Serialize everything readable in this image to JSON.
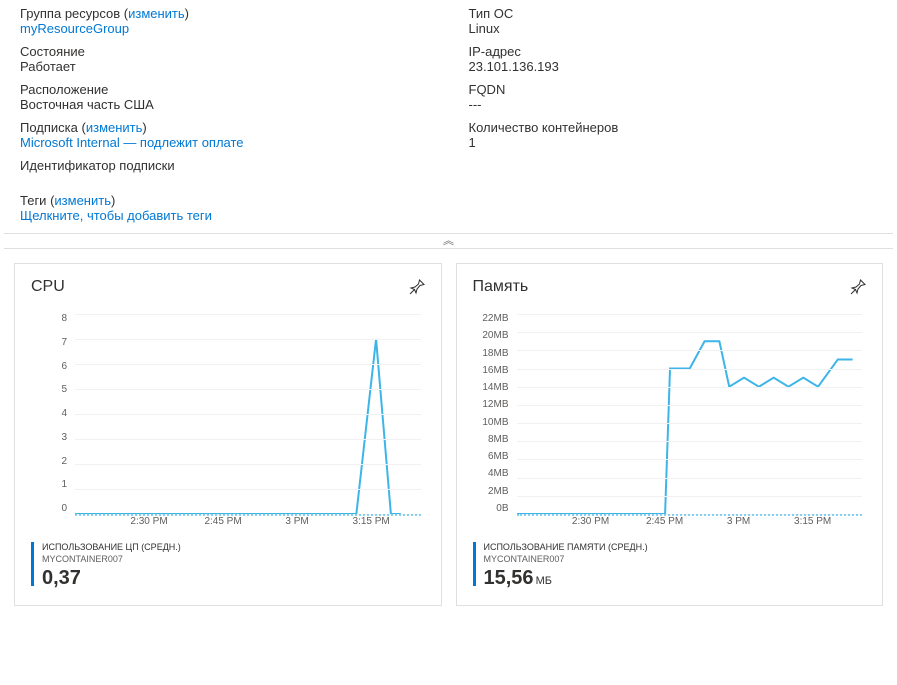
{
  "overview": {
    "left": [
      {
        "label": "Группа ресурсов",
        "changeLink": "изменить",
        "value": "myResourceGroup",
        "valueIsLink": true
      },
      {
        "label": "Состояние",
        "value": "Работает"
      },
      {
        "label": "Расположение",
        "value": "Восточная часть США"
      },
      {
        "label": "Подписка",
        "changeLink": "изменить",
        "value": "Microsoft Internal — подлежит оплате",
        "valueIsLink": true
      },
      {
        "label": "Идентификатор подписки",
        "value": ""
      }
    ],
    "right": [
      {
        "label": "Тип ОС",
        "value": "Linux"
      },
      {
        "label": "IP-адрес",
        "value": "23.101.136.193"
      },
      {
        "label": "FQDN",
        "value": "---"
      },
      {
        "label": "Количество контейнеров",
        "value": "1"
      }
    ],
    "tags": {
      "label": "Теги",
      "changeLink": "изменить",
      "addLink": "Щелкните, чтобы добавить теги"
    }
  },
  "collapseGlyph": "︽",
  "charts": {
    "cpu": {
      "title": "CPU",
      "metricName": "ИСПОЛЬЗОВАНИЕ ЦП (СРЕДН.)",
      "resource": "MYCONTAINER007",
      "value": "0,37",
      "unit": ""
    },
    "memory": {
      "title": "Память",
      "metricName": "ИСПОЛЬЗОВАНИЕ ПАМЯТИ (СРЕДН.)",
      "resource": "MYCONTAINER007",
      "value": "15,56",
      "unit": "МБ"
    }
  },
  "chart_data": [
    {
      "type": "line",
      "title": "CPU",
      "ylabel": "",
      "xlabel": "",
      "ylim": [
        0,
        8
      ],
      "y_ticks": [
        0,
        1,
        2,
        3,
        4,
        5,
        6,
        7,
        8
      ],
      "x_ticks": [
        "2:30 PM",
        "2:45 PM",
        "3 PM",
        "3:15 PM"
      ],
      "x_range_minutes": [
        135,
        205
      ],
      "series": [
        {
          "name": "ИСПОЛЬЗОВАНИЕ ЦП (СРЕДН.) — MYCONTAINER007",
          "points": [
            {
              "t": 135,
              "v": 0
            },
            {
              "t": 192,
              "v": 0
            },
            {
              "t": 196,
              "v": 7
            },
            {
              "t": 199,
              "v": 0
            },
            {
              "t": 201,
              "v": 0
            }
          ]
        }
      ]
    },
    {
      "type": "line",
      "title": "Память",
      "ylabel": "",
      "xlabel": "",
      "ylim": [
        0,
        22
      ],
      "y_ticks_labels": [
        "0B",
        "2MB",
        "4MB",
        "6MB",
        "8MB",
        "10MB",
        "12MB",
        "14MB",
        "16MB",
        "18MB",
        "20MB",
        "22MB"
      ],
      "x_ticks": [
        "2:30 PM",
        "2:45 PM",
        "3 PM",
        "3:15 PM"
      ],
      "x_range_minutes": [
        135,
        205
      ],
      "series": [
        {
          "name": "ИСПОЛЬЗОВАНИЕ ПАМЯТИ (СРЕДН.) — MYCONTAINER007",
          "points": [
            {
              "t": 135,
              "v": 0
            },
            {
              "t": 165,
              "v": 0
            },
            {
              "t": 166,
              "v": 16
            },
            {
              "t": 170,
              "v": 16
            },
            {
              "t": 173,
              "v": 19
            },
            {
              "t": 176,
              "v": 19
            },
            {
              "t": 178,
              "v": 14
            },
            {
              "t": 181,
              "v": 15
            },
            {
              "t": 184,
              "v": 14
            },
            {
              "t": 187,
              "v": 15
            },
            {
              "t": 190,
              "v": 14
            },
            {
              "t": 193,
              "v": 15
            },
            {
              "t": 196,
              "v": 14
            },
            {
              "t": 200,
              "v": 17
            },
            {
              "t": 203,
              "v": 17
            }
          ]
        }
      ]
    }
  ]
}
